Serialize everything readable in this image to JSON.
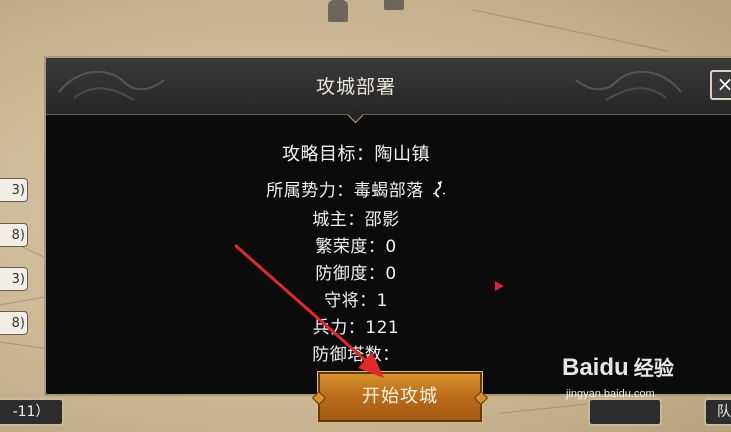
{
  "dialog": {
    "title": "攻城部署",
    "close_label": "×",
    "target_label": "攻略目标：陶山镇",
    "faction_label": "所属势力：毒蝎部落",
    "lord_label": "城主：邵影",
    "prosperity_label": "繁荣度：0",
    "defense_label": "防御度：0",
    "generals_label": "守将：1",
    "troops_label": "兵力：121",
    "towers_label": "防御塔数：",
    "start_button": "开始攻城"
  },
  "side_buttons": [
    "3)",
    "8)",
    "3)",
    "8)"
  ],
  "bottom_left_button": "-11）",
  "bottom_right_buttons": [
    "",
    "队"
  ],
  "watermark": {
    "logo": "Bai",
    "logo2": "du",
    "cn": "经验",
    "url": "jingyan.baidu.com"
  },
  "icons": {
    "faction": "scorpion-icon",
    "close": "close-icon",
    "marker": "red-triangle-marker",
    "annotation": "red-arrow"
  },
  "colors": {
    "dialog_bg": "#0b0b0b",
    "start_button": "#c27a22",
    "arrow": "#e02a2a",
    "map_bg": "#cdb996"
  }
}
